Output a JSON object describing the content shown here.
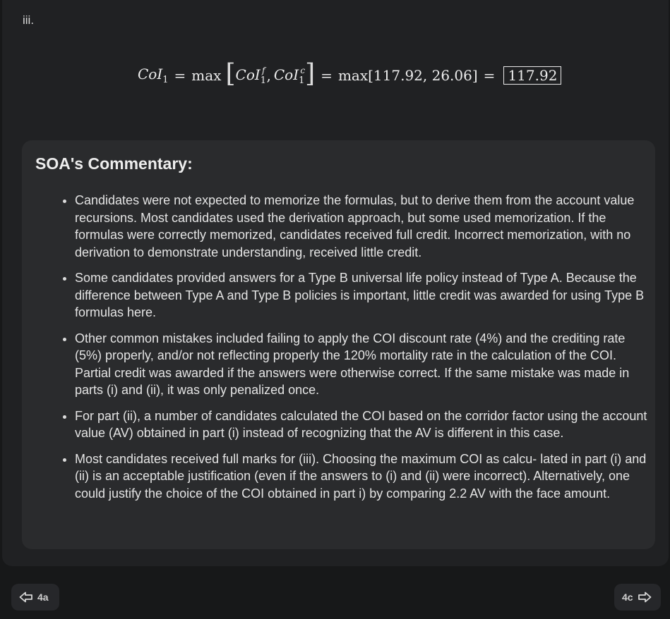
{
  "item_number": "iii.",
  "formula": {
    "lhs_base": "CoI",
    "lhs_sub": "1",
    "eq": "=",
    "max": "max",
    "arg1_base": "CoI",
    "arg1_sub": "1",
    "arg1_sup": "f",
    "comma": ",",
    "arg2_base": "CoI",
    "arg2_sub": "1",
    "arg2_sup": "c",
    "values_text": "max[117.92, 26.06]",
    "result": "117.92"
  },
  "commentary": {
    "title": "SOA's Commentary:",
    "items": [
      "Candidates were not expected to memorize the formulas, but to derive them from the account value recursions. Most candidates used the derivation approach, but some used memorization. If the formulas were correctly memorized, candidates received full credit. Incorrect memorization, with no derivation to demonstrate understanding, received little credit.",
      "Some candidates provided answers for a Type B universal life policy instead of Type A. Because the difference between Type A and Type B policies is important, little credit was awarded for using Type B formulas here.",
      "Other common mistakes included failing to apply the COI discount rate (4%) and the crediting rate (5%) properly, and/or not reflecting properly the 120% mortality rate in the calculation of the COI. Partial credit was awarded if the answers were otherwise correct. If the same mistake was made in parts (i) and (ii), it was only penalized once.",
      "For part (ii), a number of candidates calculated the COI based on the corridor factor using the account value (AV) obtained in part (i) instead of recognizing that the AV is different in this case.",
      "Most candidates received full marks for (iii). Choosing the maximum COI as calcu- lated in part (i) and (ii) is an acceptable justification (even if the answers to (i) and (ii) were incorrect). Alternatively, one could justify the choice of the COI obtained in part i) by comparing 2.2 AV with the face amount."
    ]
  },
  "nav": {
    "prev_label": "4a",
    "next_label": "4c",
    "prev_icon": "arrow-left-icon",
    "next_icon": "arrow-right-icon"
  }
}
